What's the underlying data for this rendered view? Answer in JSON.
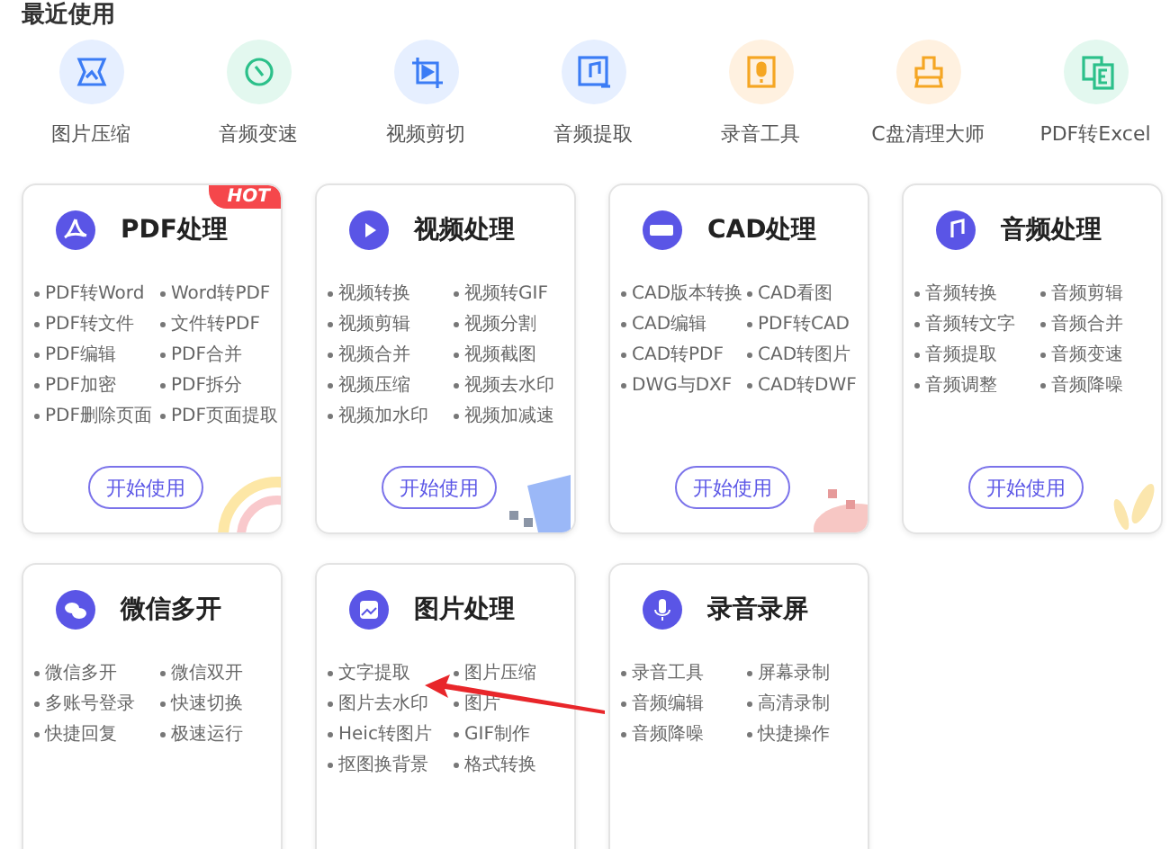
{
  "recent": {
    "title": "最近使用",
    "items": [
      {
        "label": "图片压缩",
        "color": "#e6efff"
      },
      {
        "label": "音频变速",
        "color": "#e3f8ef"
      },
      {
        "label": "视频剪切",
        "color": "#e6efff"
      },
      {
        "label": "音频提取",
        "color": "#e6efff"
      },
      {
        "label": "录音工具",
        "color": "#fff1e0"
      },
      {
        "label": "C盘清理大师",
        "color": "#fff1e0"
      },
      {
        "label": "PDF转Excel",
        "color": "#e3f8ef"
      }
    ]
  },
  "cards": [
    {
      "title": "PDF处理",
      "hot": "HOT",
      "items": [
        "PDF转Word",
        "Word转PDF",
        "PDF转文件",
        "文件转PDF",
        "PDF编辑",
        "PDF合并",
        "PDF加密",
        "PDF拆分",
        "PDF删除页面",
        "PDF页面提取"
      ],
      "button": "开始使用"
    },
    {
      "title": "视频处理",
      "items": [
        "视频转换",
        "视频转GIF",
        "视频剪辑",
        "视频分割",
        "视频合并",
        "视频截图",
        "视频压缩",
        "视频去水印",
        "视频加水印",
        "视频加减速"
      ],
      "button": "开始使用"
    },
    {
      "title": "CAD处理",
      "items": [
        "CAD版本转换",
        "CAD看图",
        "CAD编辑",
        "PDF转CAD",
        "CAD转PDF",
        "CAD转图片",
        "DWG与DXF",
        "CAD转DWF"
      ],
      "button": "开始使用"
    },
    {
      "title": "音频处理",
      "items": [
        "音频转换",
        "音频剪辑",
        "音频转文字",
        "音频合并",
        "音频提取",
        "音频变速",
        "音频调整",
        "音频降噪"
      ],
      "button": "开始使用"
    },
    {
      "title": "微信多开",
      "items": [
        "微信多开",
        "微信双开",
        "多账号登录",
        "快速切换",
        "快捷回复",
        "极速运行"
      ]
    },
    {
      "title": "图片处理",
      "items": [
        "文字提取",
        "图片压缩",
        "图片去水印",
        "图片",
        "Heic转图片",
        "GIF制作",
        "抠图换背景",
        "格式转换"
      ]
    },
    {
      "title": "录音录屏",
      "items": [
        "录音工具",
        "屏幕录制",
        "音频编辑",
        "高清录制",
        "音频降噪",
        "快捷操作"
      ]
    }
  ]
}
